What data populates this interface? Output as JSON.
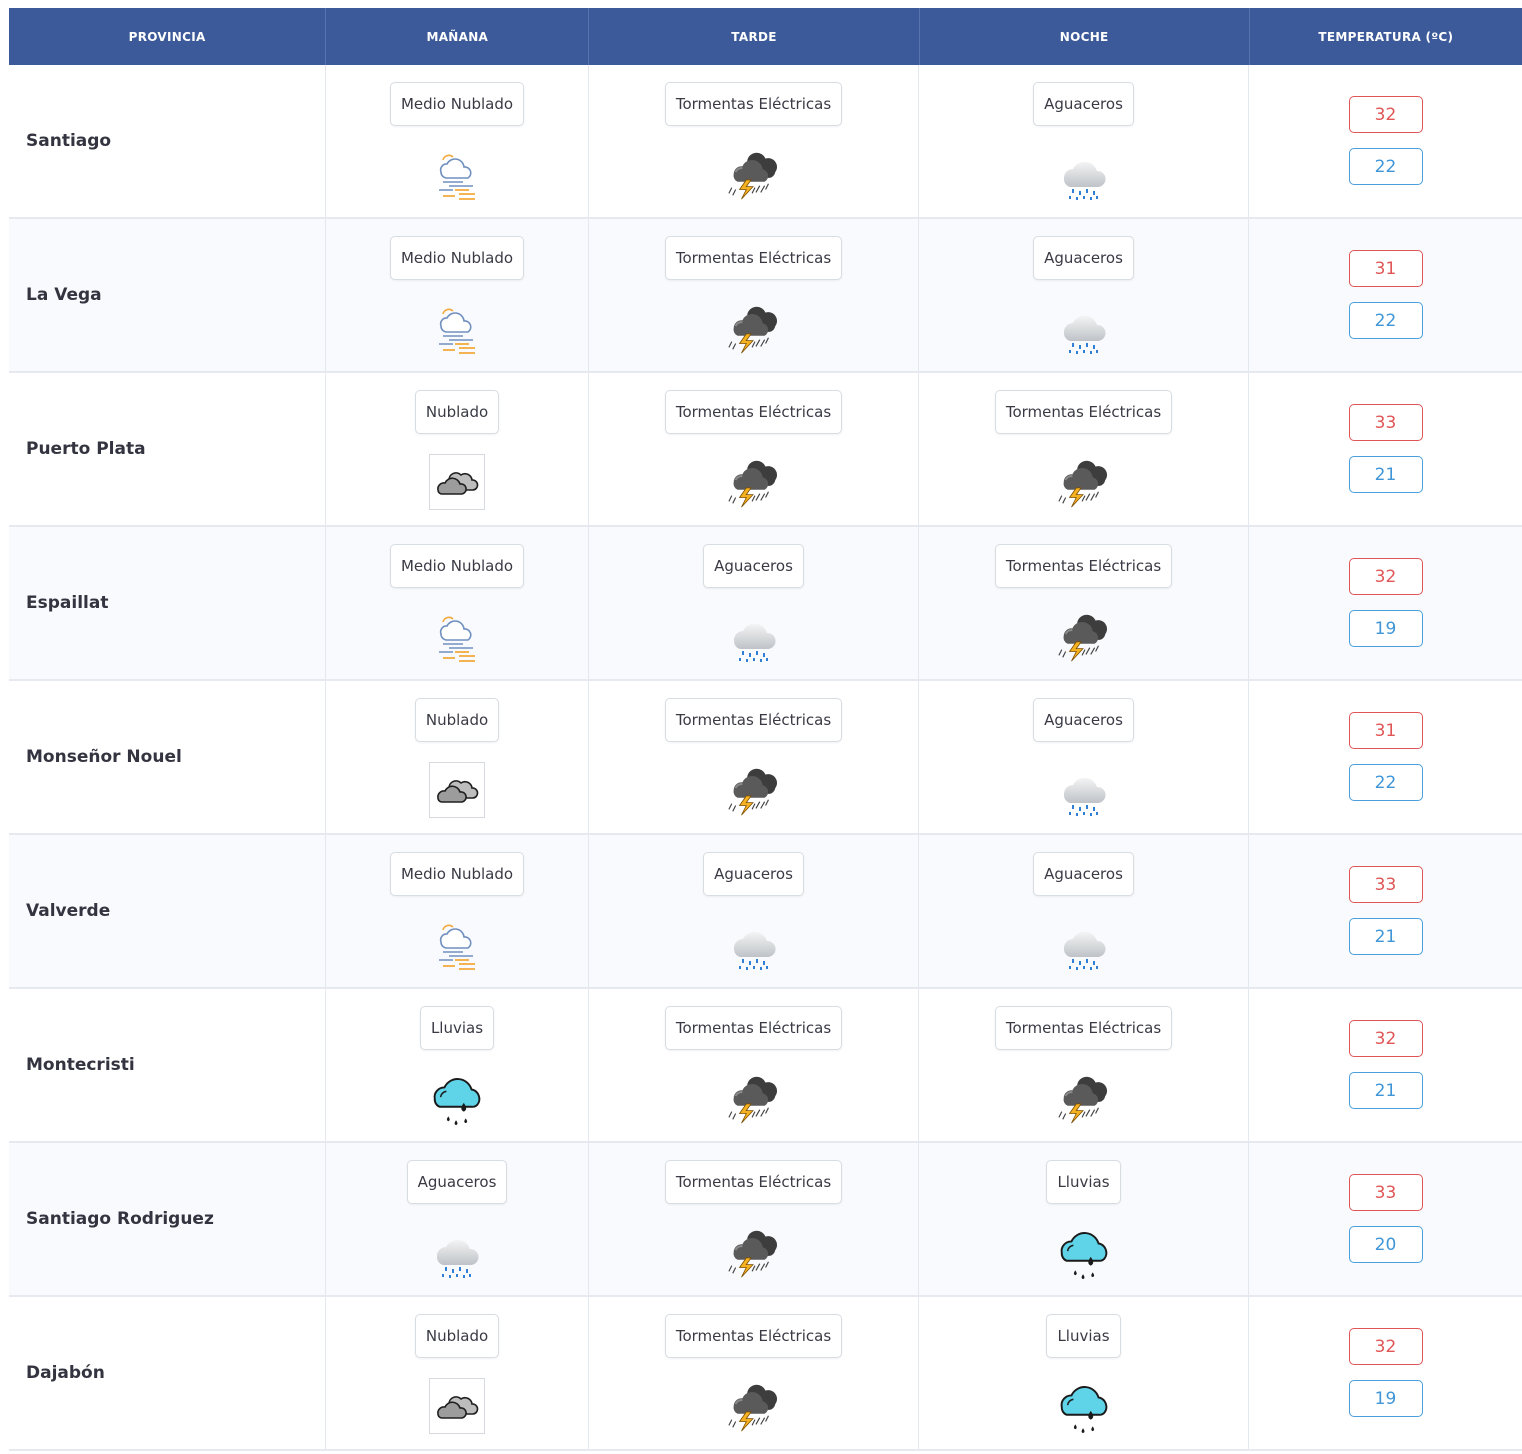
{
  "header": {
    "provincia": "PROVINCIA",
    "manana": "MAÑANA",
    "tarde": "TARDE",
    "noche": "NOCHE",
    "temperatura": "TEMPERATURA (ºC)"
  },
  "colors": {
    "header_bg": "#3c5a99",
    "max_temp": "#e05656",
    "min_temp": "#3f95d6"
  },
  "rows": [
    {
      "provincia": "Santiago",
      "manana": {
        "label": "Medio Nublado",
        "icon": "partly-cloudy-icon"
      },
      "tarde": {
        "label": "Tormentas Eléctricas",
        "icon": "thunderstorm-icon"
      },
      "noche": {
        "label": "Aguaceros",
        "icon": "showers-icon"
      },
      "max": "32",
      "min": "22"
    },
    {
      "provincia": "La Vega",
      "manana": {
        "label": "Medio Nublado",
        "icon": "partly-cloudy-icon"
      },
      "tarde": {
        "label": "Tormentas Eléctricas",
        "icon": "thunderstorm-icon"
      },
      "noche": {
        "label": "Aguaceros",
        "icon": "showers-icon"
      },
      "max": "31",
      "min": "22"
    },
    {
      "provincia": "Puerto Plata",
      "manana": {
        "label": "Nublado",
        "icon": "cloudy-icon"
      },
      "tarde": {
        "label": "Tormentas Eléctricas",
        "icon": "thunderstorm-icon"
      },
      "noche": {
        "label": "Tormentas Eléctricas",
        "icon": "thunderstorm-icon"
      },
      "max": "33",
      "min": "21"
    },
    {
      "provincia": "Espaillat",
      "manana": {
        "label": "Medio Nublado",
        "icon": "partly-cloudy-icon"
      },
      "tarde": {
        "label": "Aguaceros",
        "icon": "showers-icon"
      },
      "noche": {
        "label": "Tormentas Eléctricas",
        "icon": "thunderstorm-icon"
      },
      "max": "32",
      "min": "19"
    },
    {
      "provincia": "Monseñor Nouel",
      "manana": {
        "label": "Nublado",
        "icon": "cloudy-icon"
      },
      "tarde": {
        "label": "Tormentas Eléctricas",
        "icon": "thunderstorm-icon"
      },
      "noche": {
        "label": "Aguaceros",
        "icon": "showers-icon"
      },
      "max": "31",
      "min": "22"
    },
    {
      "provincia": "Valverde",
      "manana": {
        "label": "Medio Nublado",
        "icon": "partly-cloudy-icon"
      },
      "tarde": {
        "label": "Aguaceros",
        "icon": "showers-icon"
      },
      "noche": {
        "label": "Aguaceros",
        "icon": "showers-icon"
      },
      "max": "33",
      "min": "21"
    },
    {
      "provincia": "Montecristi",
      "manana": {
        "label": "Lluvias",
        "icon": "rain-icon"
      },
      "tarde": {
        "label": "Tormentas Eléctricas",
        "icon": "thunderstorm-icon"
      },
      "noche": {
        "label": "Tormentas Eléctricas",
        "icon": "thunderstorm-icon"
      },
      "max": "32",
      "min": "21"
    },
    {
      "provincia": "Santiago Rodriguez",
      "manana": {
        "label": "Aguaceros",
        "icon": "showers-icon"
      },
      "tarde": {
        "label": "Tormentas Eléctricas",
        "icon": "thunderstorm-icon"
      },
      "noche": {
        "label": "Lluvias",
        "icon": "rain-icon"
      },
      "max": "33",
      "min": "20"
    },
    {
      "provincia": "Dajabón",
      "manana": {
        "label": "Nublado",
        "icon": "cloudy-icon"
      },
      "tarde": {
        "label": "Tormentas Eléctricas",
        "icon": "thunderstorm-icon"
      },
      "noche": {
        "label": "Lluvias",
        "icon": "rain-icon"
      },
      "max": "32",
      "min": "19"
    }
  ]
}
